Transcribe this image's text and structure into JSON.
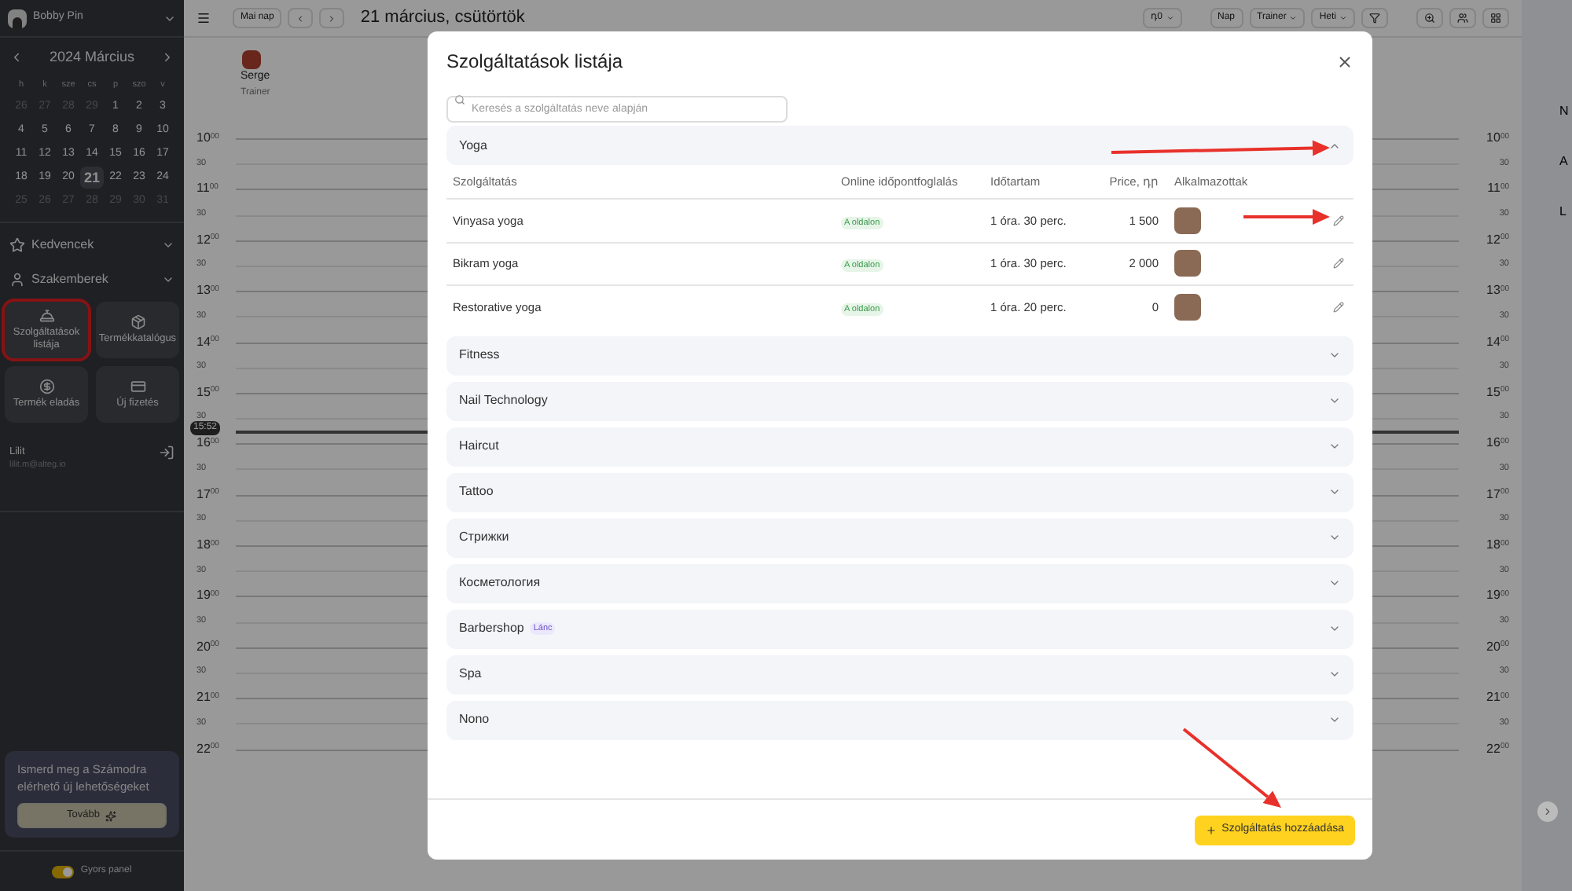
{
  "sidebar": {
    "account": "Bobby Pin",
    "calendar": {
      "title": "2024 Március",
      "weekdays": [
        "h",
        "k",
        "sze",
        "cs",
        "p",
        "szo",
        "v"
      ],
      "days": [
        {
          "label": "26",
          "muted": true,
          "selected": false
        },
        {
          "label": "27",
          "muted": true,
          "selected": false
        },
        {
          "label": "28",
          "muted": true,
          "selected": false
        },
        {
          "label": "29",
          "muted": true,
          "selected": false
        },
        {
          "label": "1",
          "muted": false,
          "selected": false
        },
        {
          "label": "2",
          "muted": false,
          "selected": false
        },
        {
          "label": "3",
          "muted": false,
          "selected": false
        },
        {
          "label": "4",
          "muted": false,
          "selected": false
        },
        {
          "label": "5",
          "muted": false,
          "selected": false
        },
        {
          "label": "6",
          "muted": false,
          "selected": false
        },
        {
          "label": "7",
          "muted": false,
          "selected": false
        },
        {
          "label": "8",
          "muted": false,
          "selected": false
        },
        {
          "label": "9",
          "muted": false,
          "selected": false
        },
        {
          "label": "10",
          "muted": false,
          "selected": false
        },
        {
          "label": "11",
          "muted": false,
          "selected": false
        },
        {
          "label": "12",
          "muted": false,
          "selected": false
        },
        {
          "label": "13",
          "muted": false,
          "selected": false
        },
        {
          "label": "14",
          "muted": false,
          "selected": false
        },
        {
          "label": "15",
          "muted": false,
          "selected": false
        },
        {
          "label": "16",
          "muted": false,
          "selected": false
        },
        {
          "label": "17",
          "muted": false,
          "selected": false
        },
        {
          "label": "18",
          "muted": false,
          "selected": false
        },
        {
          "label": "19",
          "muted": false,
          "selected": false
        },
        {
          "label": "20",
          "muted": false,
          "selected": false
        },
        {
          "label": "21",
          "muted": false,
          "selected": true
        },
        {
          "label": "22",
          "muted": false,
          "selected": false
        },
        {
          "label": "23",
          "muted": false,
          "selected": false
        },
        {
          "label": "24",
          "muted": false,
          "selected": false
        },
        {
          "label": "25",
          "muted": true,
          "selected": false
        },
        {
          "label": "26",
          "muted": true,
          "selected": false
        },
        {
          "label": "27",
          "muted": true,
          "selected": false
        },
        {
          "label": "28",
          "muted": true,
          "selected": false
        },
        {
          "label": "29",
          "muted": true,
          "selected": false
        },
        {
          "label": "30",
          "muted": true,
          "selected": false
        },
        {
          "label": "31",
          "muted": true,
          "selected": false
        }
      ]
    },
    "sections": [
      {
        "label": "Kedvencek",
        "kind": "star"
      },
      {
        "label": "Szakemberek",
        "kind": "person"
      }
    ],
    "tiles": [
      {
        "label": "Szolgáltatások listája",
        "kind": "services",
        "highlighted": true
      },
      {
        "label": "Termékkatalógus",
        "kind": "catalog",
        "highlighted": false
      },
      {
        "label": "Termék eladás",
        "kind": "sale",
        "highlighted": false
      },
      {
        "label": "Új fizetés",
        "kind": "payment",
        "highlighted": false
      }
    ],
    "user": {
      "name": "Lilit",
      "email": "lilit.m@alteg.io"
    },
    "promo": {
      "text": "Ismerd meg a Számodra elérhető új lehetőségeket",
      "button": "Tovább"
    },
    "quick_panel": {
      "label": "Gyors panel",
      "on": true
    }
  },
  "toolbar": {
    "today": "Mai nap",
    "date": "21 március, csütörtök",
    "currency": "դ0",
    "view": "Nap",
    "staff": "Trainer",
    "period": "Heti"
  },
  "staff": {
    "name": "Serge",
    "role": "Trainer"
  },
  "calendar": {
    "now": "15:52",
    "left_times": [
      {
        "hour": "10",
        "minute": "00"
      },
      {
        "minute": "30"
      },
      {
        "hour": "11",
        "minute": "00"
      },
      {
        "minute": "30"
      },
      {
        "hour": "12",
        "minute": "00"
      },
      {
        "minute": "30"
      },
      {
        "hour": "13",
        "minute": "00"
      },
      {
        "minute": "30"
      },
      {
        "hour": "14",
        "minute": "00"
      },
      {
        "minute": "30"
      },
      {
        "hour": "15",
        "minute": "00"
      },
      {
        "minute": "30"
      },
      {
        "hour": "16",
        "minute": "00"
      },
      {
        "minute": "30"
      },
      {
        "hour": "17",
        "minute": "00"
      },
      {
        "minute": "30"
      },
      {
        "hour": "18",
        "minute": "00"
      },
      {
        "minute": "30"
      },
      {
        "hour": "19",
        "minute": "00"
      },
      {
        "minute": "30"
      },
      {
        "hour": "20",
        "minute": "00"
      },
      {
        "minute": "30"
      },
      {
        "hour": "21",
        "minute": "00"
      },
      {
        "minute": "30"
      },
      {
        "hour": "22",
        "minute": "00"
      }
    ],
    "right_times": [
      {
        "hour": "10",
        "minute": "00"
      },
      {
        "minute": "30"
      },
      {
        "hour": "11",
        "minute": "00"
      },
      {
        "minute": "30"
      },
      {
        "hour": "12",
        "minute": "00"
      },
      {
        "minute": "30"
      },
      {
        "hour": "13",
        "minute": "00"
      },
      {
        "minute": "30"
      },
      {
        "hour": "14",
        "minute": "00"
      },
      {
        "minute": "30"
      },
      {
        "hour": "15",
        "minute": "00"
      },
      {
        "minute": "30"
      },
      {
        "hour": "16",
        "minute": "00"
      },
      {
        "minute": "30"
      },
      {
        "hour": "17",
        "minute": "00"
      },
      {
        "minute": "30"
      },
      {
        "hour": "18",
        "minute": "00"
      },
      {
        "minute": "30"
      },
      {
        "hour": "19",
        "minute": "00"
      },
      {
        "minute": "30"
      },
      {
        "hour": "20",
        "minute": "00"
      },
      {
        "minute": "30"
      },
      {
        "hour": "21",
        "minute": "00"
      },
      {
        "minute": "30"
      },
      {
        "hour": "22",
        "minute": "00"
      }
    ]
  },
  "right_panel": {
    "labels": [
      "N",
      "A",
      "L"
    ]
  },
  "modal": {
    "title": "Szolgáltatások listája",
    "search": {
      "placeholder": "Keresés a szolgáltatás neve alapján"
    },
    "columns": [
      "Szolgáltatás",
      "Online időpontfoglalás",
      "Időtartam",
      "Price, դր",
      "Alkalmazottak"
    ],
    "groups": [
      {
        "name": "Yoga",
        "expanded": true,
        "rows": [
          {
            "service": "Vinyasa yoga",
            "online": "A oldalon",
            "duration": "1 óra. 30 perc.",
            "price": "1 500"
          },
          {
            "service": "Bikram yoga",
            "online": "A oldalon",
            "duration": "1 óra. 30 perc.",
            "price": "2 000"
          },
          {
            "service": "Restorative yoga",
            "online": "A oldalon",
            "duration": "1 óra. 20 perc.",
            "price": "0"
          }
        ]
      },
      {
        "name": "Fitness",
        "expanded": false
      },
      {
        "name": "Nail Technology",
        "expanded": false
      },
      {
        "name": "Haircut",
        "expanded": false
      },
      {
        "name": "Tattoo",
        "expanded": false
      },
      {
        "name": "Стрижки",
        "expanded": false
      },
      {
        "name": "Косметология",
        "expanded": false
      },
      {
        "name": "Barbershop",
        "badge": "Lánc",
        "expanded": false
      },
      {
        "name": "Spa",
        "expanded": false
      },
      {
        "name": "Nono",
        "expanded": false
      }
    ],
    "add_button": "Szolgáltatás hozzáadása"
  }
}
